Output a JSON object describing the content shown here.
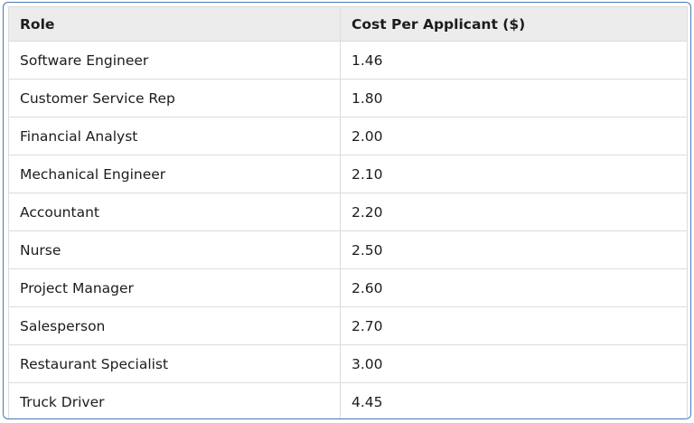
{
  "table": {
    "headers": [
      "Role",
      "Cost Per Applicant ($)"
    ],
    "rows": [
      [
        "Software Engineer",
        "1.46"
      ],
      [
        "Customer Service Rep",
        "1.80"
      ],
      [
        "Financial Analyst",
        "2.00"
      ],
      [
        "Mechanical Engineer",
        "2.10"
      ],
      [
        "Accountant",
        "2.20"
      ],
      [
        "Nurse",
        "2.50"
      ],
      [
        "Project Manager",
        "2.60"
      ],
      [
        "Salesperson",
        "2.70"
      ],
      [
        "Restaurant Specialist",
        "3.00"
      ],
      [
        "Truck Driver",
        "4.45"
      ]
    ]
  },
  "colors": {
    "frame_border": "#4a78b8",
    "header_bg": "#ececec",
    "cell_border": "#dcdcdc"
  }
}
